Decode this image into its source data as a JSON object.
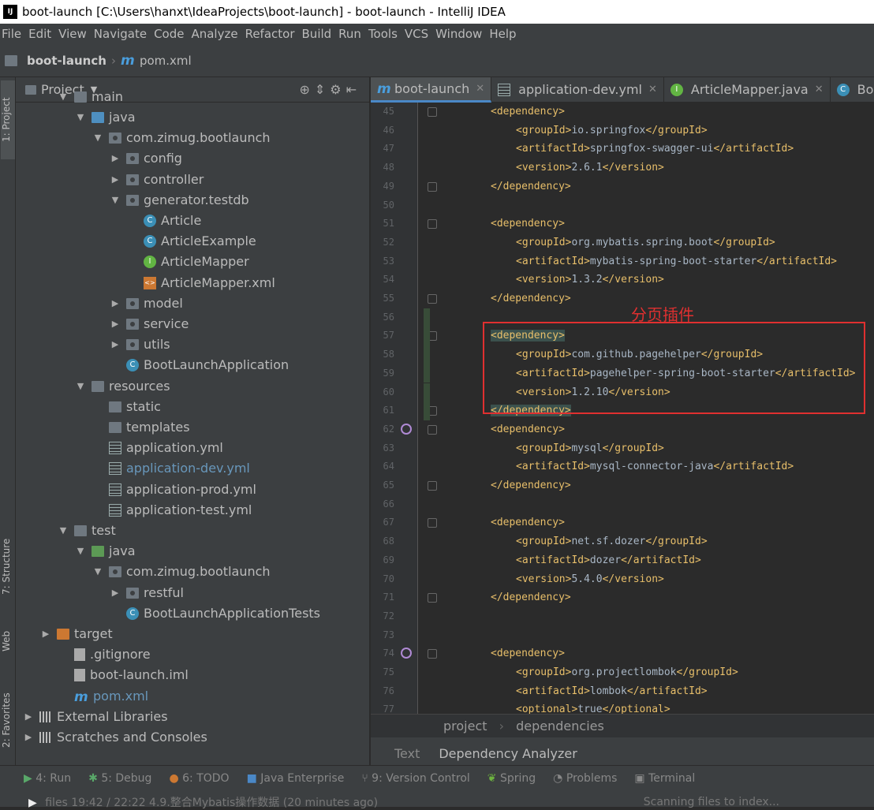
{
  "window": {
    "title": "boot-launch [C:\\Users\\hanxt\\IdeaProjects\\boot-launch] - boot-launch - IntelliJ IDEA"
  },
  "menu": [
    "File",
    "Edit",
    "View",
    "Navigate",
    "Code",
    "Analyze",
    "Refactor",
    "Build",
    "Run",
    "Tools",
    "VCS",
    "Window",
    "Help"
  ],
  "nav": {
    "project": "boot-launch",
    "file": "pom.xml"
  },
  "sidestrip": {
    "project": "1: Project",
    "structure": "7: Structure",
    "web": "Web",
    "favorites": "2: Favorites"
  },
  "project_panel": {
    "title": "Project",
    "tree": [
      {
        "label": "main",
        "indent": 1,
        "arrow": "open",
        "icon": "folder"
      },
      {
        "label": "java",
        "indent": 2,
        "arrow": "open",
        "icon": "src"
      },
      {
        "label": "com.zimug.bootlaunch",
        "indent": 3,
        "arrow": "open",
        "icon": "pkg"
      },
      {
        "label": "config",
        "indent": 4,
        "arrow": "closed",
        "icon": "pkg"
      },
      {
        "label": "controller",
        "indent": 4,
        "arrow": "closed",
        "icon": "pkg"
      },
      {
        "label": "generator.testdb",
        "indent": 4,
        "arrow": "open",
        "icon": "pkg"
      },
      {
        "label": "Article",
        "indent": 5,
        "arrow": "none",
        "icon": "class"
      },
      {
        "label": "ArticleExample",
        "indent": 5,
        "arrow": "none",
        "icon": "class"
      },
      {
        "label": "ArticleMapper",
        "indent": 5,
        "arrow": "none",
        "icon": "iface"
      },
      {
        "label": "ArticleMapper.xml",
        "indent": 5,
        "arrow": "none",
        "icon": "xml"
      },
      {
        "label": "model",
        "indent": 4,
        "arrow": "closed",
        "icon": "pkg"
      },
      {
        "label": "service",
        "indent": 4,
        "arrow": "closed",
        "icon": "pkg"
      },
      {
        "label": "utils",
        "indent": 4,
        "arrow": "closed",
        "icon": "pkg"
      },
      {
        "label": "BootLaunchApplication",
        "indent": 4,
        "arrow": "none",
        "icon": "class"
      },
      {
        "label": "resources",
        "indent": 2,
        "arrow": "open",
        "icon": "res"
      },
      {
        "label": "static",
        "indent": 3,
        "arrow": "none",
        "icon": "folder"
      },
      {
        "label": "templates",
        "indent": 3,
        "arrow": "none",
        "icon": "folder"
      },
      {
        "label": "application.yml",
        "indent": 3,
        "arrow": "none",
        "icon": "yml"
      },
      {
        "label": "application-dev.yml",
        "indent": 3,
        "arrow": "none",
        "icon": "yml",
        "highlight": true
      },
      {
        "label": "application-prod.yml",
        "indent": 3,
        "arrow": "none",
        "icon": "yml"
      },
      {
        "label": "application-test.yml",
        "indent": 3,
        "arrow": "none",
        "icon": "yml"
      },
      {
        "label": "test",
        "indent": 1,
        "arrow": "open",
        "icon": "folder"
      },
      {
        "label": "java",
        "indent": 2,
        "arrow": "open",
        "icon": "test"
      },
      {
        "label": "com.zimug.bootlaunch",
        "indent": 3,
        "arrow": "open",
        "icon": "pkg"
      },
      {
        "label": "restful",
        "indent": 4,
        "arrow": "closed",
        "icon": "pkg"
      },
      {
        "label": "BootLaunchApplicationTests",
        "indent": 4,
        "arrow": "none",
        "icon": "class"
      },
      {
        "label": "target",
        "indent": 0,
        "arrow": "closed",
        "icon": "target"
      },
      {
        "label": ".gitignore",
        "indent": 1,
        "arrow": "none",
        "icon": "file"
      },
      {
        "label": "boot-launch.iml",
        "indent": 1,
        "arrow": "none",
        "icon": "file"
      },
      {
        "label": "pom.xml",
        "indent": 1,
        "arrow": "none",
        "icon": "m",
        "highlight": true
      },
      {
        "label": "External Libraries",
        "indent": -1,
        "arrow": "closed",
        "icon": "lib"
      },
      {
        "label": "Scratches and Consoles",
        "indent": -1,
        "arrow": "closed",
        "icon": "lib"
      }
    ]
  },
  "tabs": [
    {
      "label": "boot-launch",
      "icon": "m",
      "active": true
    },
    {
      "label": "application-dev.yml",
      "icon": "yml",
      "active": false
    },
    {
      "label": "ArticleMapper.java",
      "icon": "iface",
      "active": false
    },
    {
      "label": "BootLa",
      "icon": "class",
      "active": false
    }
  ],
  "code": [
    {
      "n": "45",
      "t": [
        [
          "tg",
          "<dependency>"
        ]
      ],
      "ind": 0
    },
    {
      "n": "46",
      "t": [
        [
          "tg",
          "<groupId>"
        ],
        [
          "tx",
          "io.springfox"
        ],
        [
          "tg",
          "</groupId>"
        ]
      ],
      "ind": 1
    },
    {
      "n": "47",
      "t": [
        [
          "tg",
          "<artifactId>"
        ],
        [
          "tx",
          "springfox-swagger-ui"
        ],
        [
          "tg",
          "</artifactId>"
        ]
      ],
      "ind": 1
    },
    {
      "n": "48",
      "t": [
        [
          "tg",
          "<version>"
        ],
        [
          "tx",
          "2.6.1"
        ],
        [
          "tg",
          "</version>"
        ]
      ],
      "ind": 1
    },
    {
      "n": "49",
      "t": [
        [
          "tg",
          "</dependency>"
        ]
      ],
      "ind": 0
    },
    {
      "n": "50",
      "t": [],
      "ind": 0
    },
    {
      "n": "51",
      "t": [
        [
          "tg",
          "<dependency>"
        ]
      ],
      "ind": 0
    },
    {
      "n": "52",
      "t": [
        [
          "tg",
          "<groupId>"
        ],
        [
          "tx",
          "org.mybatis.spring.boot"
        ],
        [
          "tg",
          "</groupId>"
        ]
      ],
      "ind": 1
    },
    {
      "n": "53",
      "t": [
        [
          "tg",
          "<artifactId>"
        ],
        [
          "tx",
          "mybatis-spring-boot-starter"
        ],
        [
          "tg",
          "</artifactId>"
        ]
      ],
      "ind": 1
    },
    {
      "n": "54",
      "t": [
        [
          "tg",
          "<version>"
        ],
        [
          "tx",
          "1.3.2"
        ],
        [
          "tg",
          "</version>"
        ]
      ],
      "ind": 1
    },
    {
      "n": "55",
      "t": [
        [
          "tg",
          "</dependency>"
        ]
      ],
      "ind": 0
    },
    {
      "n": "56",
      "t": [],
      "ind": 0
    },
    {
      "n": "57",
      "t": [
        [
          "tg",
          "<dependency>"
        ]
      ],
      "ind": 0
    },
    {
      "n": "58",
      "t": [
        [
          "tg",
          "<groupId>"
        ],
        [
          "tx",
          "com.github.pagehelper"
        ],
        [
          "tg",
          "</groupId>"
        ]
      ],
      "ind": 1
    },
    {
      "n": "59",
      "t": [
        [
          "tg",
          "<artifactId>"
        ],
        [
          "tx",
          "pagehelper-spring-boot-starter"
        ],
        [
          "tg",
          "</artifactId>"
        ]
      ],
      "ind": 1
    },
    {
      "n": "60",
      "t": [
        [
          "tg",
          "<version>"
        ],
        [
          "tx",
          "1.2.10"
        ],
        [
          "tg",
          "</version>"
        ]
      ],
      "ind": 1
    },
    {
      "n": "61",
      "t": [
        [
          "tg",
          "</dependency>"
        ]
      ],
      "ind": 0
    },
    {
      "n": "62",
      "t": [
        [
          "tg",
          "<dependency>"
        ]
      ],
      "ind": 0
    },
    {
      "n": "63",
      "t": [
        [
          "tg",
          "<groupId>"
        ],
        [
          "tx",
          "mysql"
        ],
        [
          "tg",
          "</groupId>"
        ]
      ],
      "ind": 1
    },
    {
      "n": "64",
      "t": [
        [
          "tg",
          "<artifactId>"
        ],
        [
          "tx",
          "mysql-connector-java"
        ],
        [
          "tg",
          "</artifactId>"
        ]
      ],
      "ind": 1
    },
    {
      "n": "65",
      "t": [
        [
          "tg",
          "</dependency>"
        ]
      ],
      "ind": 0
    },
    {
      "n": "66",
      "t": [],
      "ind": 0
    },
    {
      "n": "67",
      "t": [
        [
          "tg",
          "<dependency>"
        ]
      ],
      "ind": 0
    },
    {
      "n": "68",
      "t": [
        [
          "tg",
          "<groupId>"
        ],
        [
          "tx",
          "net.sf.dozer"
        ],
        [
          "tg",
          "</groupId>"
        ]
      ],
      "ind": 1
    },
    {
      "n": "69",
      "t": [
        [
          "tg",
          "<artifactId>"
        ],
        [
          "tx",
          "dozer"
        ],
        [
          "tg",
          "</artifactId>"
        ]
      ],
      "ind": 1
    },
    {
      "n": "70",
      "t": [
        [
          "tg",
          "<version>"
        ],
        [
          "tx",
          "5.4.0"
        ],
        [
          "tg",
          "</version>"
        ]
      ],
      "ind": 1
    },
    {
      "n": "71",
      "t": [
        [
          "tg",
          "</dependency>"
        ]
      ],
      "ind": 0
    },
    {
      "n": "72",
      "t": [],
      "ind": 0
    },
    {
      "n": "73",
      "t": [],
      "ind": 0
    },
    {
      "n": "74",
      "t": [
        [
          "tg",
          "<dependency>"
        ]
      ],
      "ind": 0
    },
    {
      "n": "75",
      "t": [
        [
          "tg",
          "<groupId>"
        ],
        [
          "tx",
          "org.projectlombok"
        ],
        [
          "tg",
          "</groupId>"
        ]
      ],
      "ind": 1
    },
    {
      "n": "76",
      "t": [
        [
          "tg",
          "<artifactId>"
        ],
        [
          "tx",
          "lombok"
        ],
        [
          "tg",
          "</artifactId>"
        ]
      ],
      "ind": 1
    },
    {
      "n": "77",
      "t": [
        [
          "tg",
          "<optional>"
        ],
        [
          "tx",
          "true"
        ],
        [
          "tg",
          "</optional>"
        ]
      ],
      "ind": 1
    }
  ],
  "annotation": "分页插件",
  "breadcrumb": {
    "a": "project",
    "b": "dependencies"
  },
  "bottom_tabs": {
    "text": "Text",
    "analyzer": "Dependency Analyzer"
  },
  "toolwindows": [
    "4: Run",
    "5: Debug",
    "6: TODO",
    "Java Enterprise",
    "9: Version Control",
    "Spring",
    "Problems",
    "Terminal"
  ],
  "status": {
    "message": "files  19:42 / 22:22    4.9.整合Mybatis操作数据 (20 minutes ago)",
    "scanning": "Scanning files to index..."
  },
  "colors": {
    "accent": "#4a88c7",
    "annotation": "#e03030",
    "tag": "#e8bf6a"
  }
}
